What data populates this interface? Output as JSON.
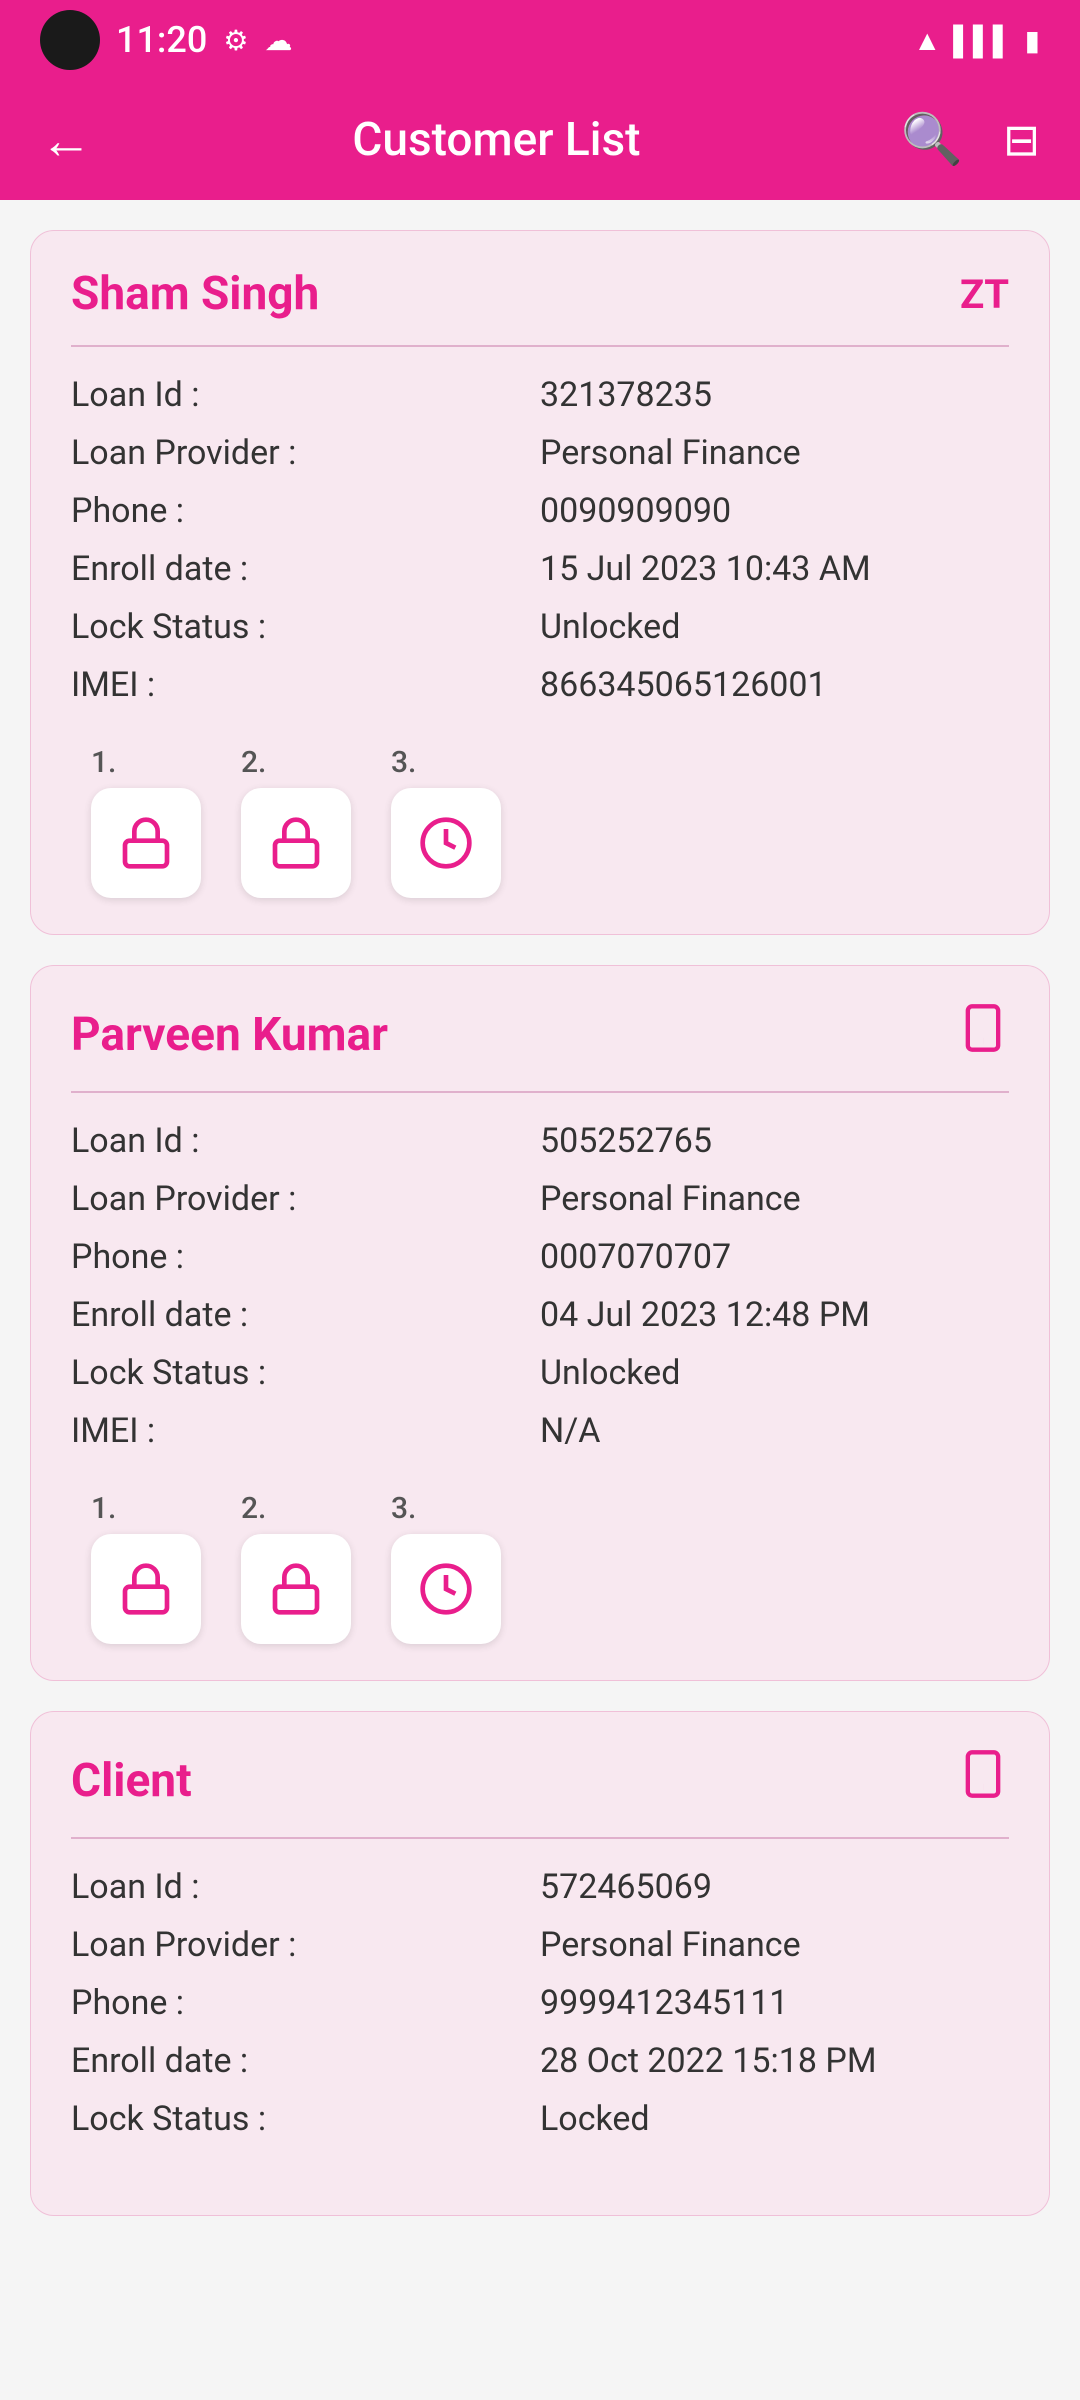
{
  "statusBar": {
    "time": "11:20",
    "icons": [
      "settings",
      "cloud",
      "wifi",
      "signal",
      "battery"
    ]
  },
  "appBar": {
    "title": "Customer List",
    "backLabel": "←",
    "searchLabel": "🔍",
    "filterLabel": "⊟"
  },
  "customers": [
    {
      "name": "Sham Singh",
      "badge": "ZT",
      "badgeType": "text",
      "loanId": "321378235",
      "loanProvider": "Personal Finance",
      "phone": "0090909090",
      "enrollDate": "15 Jul 2023 10:43 AM",
      "lockStatus": "Unlocked",
      "imei": "866345065126001",
      "actions": [
        {
          "num": "1.",
          "icon": "lock"
        },
        {
          "num": "2.",
          "icon": "lock"
        },
        {
          "num": "3.",
          "icon": "chart"
        }
      ]
    },
    {
      "name": "Parveen Kumar",
      "badge": "phone",
      "badgeType": "icon",
      "loanId": "505252765",
      "loanProvider": "Personal Finance",
      "phone": "0007070707",
      "enrollDate": "04 Jul 2023 12:48 PM",
      "lockStatus": "Unlocked",
      "imei": "N/A",
      "actions": [
        {
          "num": "1.",
          "icon": "lock"
        },
        {
          "num": "2.",
          "icon": "lock"
        },
        {
          "num": "3.",
          "icon": "chart"
        }
      ]
    },
    {
      "name": "Client",
      "badge": "phone",
      "badgeType": "icon",
      "loanId": "572465069",
      "loanProvider": "Personal Finance",
      "phone": "9999412345111",
      "enrollDate": "28 Oct 2022 15:18 PM",
      "lockStatus": "Locked",
      "imei": "",
      "actions": []
    }
  ],
  "labels": {
    "loanId": "Loan Id :",
    "loanProvider": "Loan Provider :",
    "phone": "Phone :",
    "enrollDate": "Enroll date :",
    "lockStatus": "Lock Status :",
    "imei": "IMEI :"
  }
}
